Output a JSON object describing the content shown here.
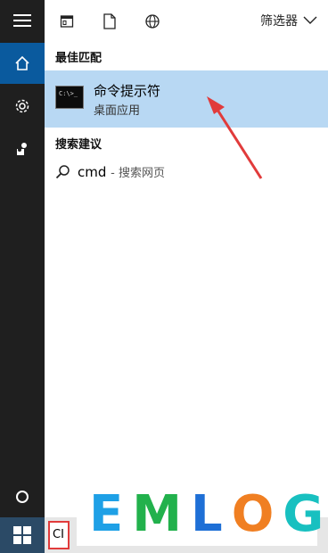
{
  "toolbar": {
    "filter_label": "筛选器"
  },
  "best_match": {
    "heading": "最佳匹配",
    "title": "命令提示符",
    "subtitle": "桌面应用",
    "icon_text": "C:\\>_"
  },
  "suggestions": {
    "heading": "搜索建议",
    "items": [
      {
        "query": "cmd",
        "suffix": "- 搜索网页"
      }
    ]
  },
  "taskbar": {
    "search_value": "CI"
  },
  "watermark": {
    "letters": [
      "E",
      "M",
      "L",
      "O",
      "G"
    ],
    "colors": [
      "#1ea0e6",
      "#22b14c",
      "#1e6fd6",
      "#f07f22",
      "#18c0c0"
    ]
  },
  "colors": {
    "accent": "#0a5a9e",
    "selection": "#b8d8f3",
    "rail": "#1f1f1f",
    "highlight_red": "#e13b3b"
  }
}
